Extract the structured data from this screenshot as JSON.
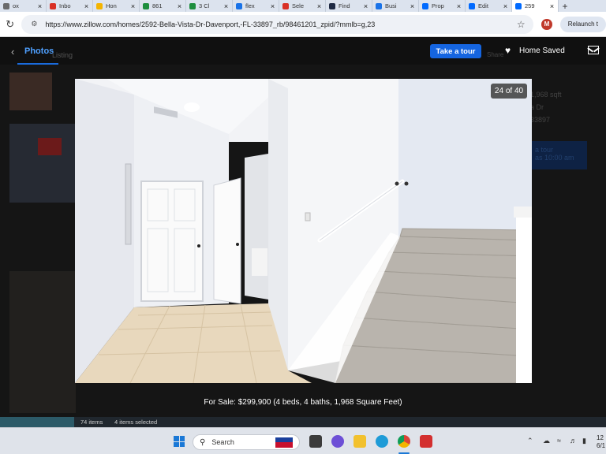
{
  "browser": {
    "tabs": [
      {
        "label": "ox",
        "icon": "page-icon",
        "color": "#6b6b6b"
      },
      {
        "label": "Inbo",
        "icon": "gmail-icon",
        "color": "#d93025"
      },
      {
        "label": "Hon",
        "icon": "google-drive-icon",
        "color": "#f4b400"
      },
      {
        "label": "861",
        "icon": "google-sheets-icon",
        "color": "#1e8e3e"
      },
      {
        "label": "3 Cl",
        "icon": "google-sheets-icon",
        "color": "#1e8e3e"
      },
      {
        "label": "flex",
        "icon": "circle-icon",
        "color": "#1a73e8"
      },
      {
        "label": "Sele",
        "icon": "tag-icon",
        "color": "#d93025"
      },
      {
        "label": "Find",
        "icon": "find-icon",
        "color": "#1f2a44"
      },
      {
        "label": "Busi",
        "icon": "business-icon",
        "color": "#1a73e8"
      },
      {
        "label": "Prop",
        "icon": "zillow-icon",
        "color": "#006aff"
      },
      {
        "label": "Edit",
        "icon": "zillow-icon",
        "color": "#006aff"
      },
      {
        "label": "259",
        "icon": "zillow-icon",
        "color": "#006aff",
        "active": true
      }
    ],
    "new_tab": "+",
    "url": "https://www.zillow.com/homes/2592-Bella-Vista-Dr-Davenport,-FL-33897_rb/98461201_zpid/?mmlb=g,23",
    "profile_initial": "M",
    "relaunch_label": "Relaunch t"
  },
  "zillow_header": {
    "photos_tab": "Photos",
    "ghost_link": "Listing",
    "tour_button": "Take a tour",
    "ghost_share": "Share",
    "saved_label": "Home Saved"
  },
  "background_page": {
    "lines": [
      "1,968 sqft",
      "a Dr",
      "33897"
    ],
    "tour_ghost": "a tour",
    "tour_ghost_sub": "as 10:00 am"
  },
  "photo": {
    "counter": "24 of 40",
    "alt": "Interior entry hallway with tile floor and carpeted staircase"
  },
  "caption": "For Sale: $299,900 (4 beds, 4 baths, 1,968 Square Feet)",
  "explorer_status": {
    "items": "74 items",
    "selected": "4 items selected"
  },
  "taskbar": {
    "search_placeholder": "Search",
    "clock_time": "12",
    "clock_date": "6/1"
  }
}
